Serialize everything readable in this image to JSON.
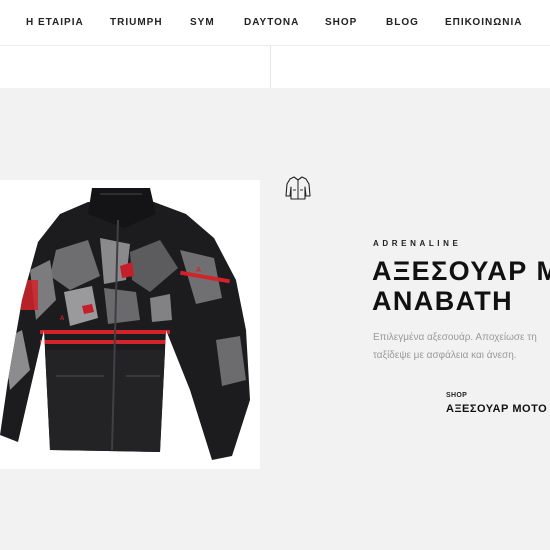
{
  "nav": {
    "items": [
      {
        "label": "Η ΕΤΑΙΡΙΑ"
      },
      {
        "label": "TRIUMPH"
      },
      {
        "label": "SYM"
      },
      {
        "label": "DAYTONA"
      },
      {
        "label": "SHOP"
      },
      {
        "label": "BLOG"
      },
      {
        "label": "ΕΠΙΚΟΙΝΩΝΙΑ"
      }
    ]
  },
  "hero": {
    "brand": "ADRENALINE",
    "title_line1": "ΑΞΕΣΟΥΑΡ Μ",
    "title_line2": "ΑΝΑΒΑΤΗ",
    "desc_line1": "Επιλεγμένα αξεσουάρ. Αποχείωσε τη",
    "desc_line2": "ταξίδεψε με ασφάλεια και άνεση.",
    "shop_label": "SHOP",
    "shop_link": "ΑΞΕΣΟΥΑΡ ΜΟΤΟ",
    "product_icon": "jacket-icon"
  },
  "colors": {
    "accent_red": "#d2232a",
    "background": "#f2f2f2"
  }
}
